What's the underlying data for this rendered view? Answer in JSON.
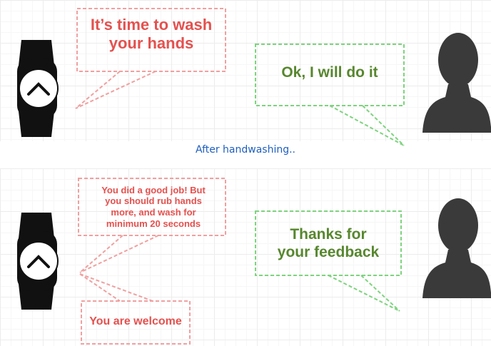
{
  "top_scene": {
    "watch_message": "It’s time to wash your hands",
    "user_reply": "Ok, I will do it"
  },
  "caption": "After handwashing..",
  "bottom_scene": {
    "watch_feedback": "You did a good job! But you should rub hands more, and wash for minimum 20 seconds",
    "user_reply": "Thanks for your feedback",
    "watch_reply": "You are welcome"
  },
  "icons": {
    "watch": "smartwatch-icon",
    "user": "person-silhouette-icon"
  },
  "colors": {
    "watch_bubble": "#e4514e",
    "user_bubble": "#57872e",
    "watch_border": "#f0a0a0",
    "user_border": "#7ed37e",
    "caption": "#1f5fbf",
    "icon_fill": "#111111",
    "person_fill": "#3a3a3a"
  }
}
